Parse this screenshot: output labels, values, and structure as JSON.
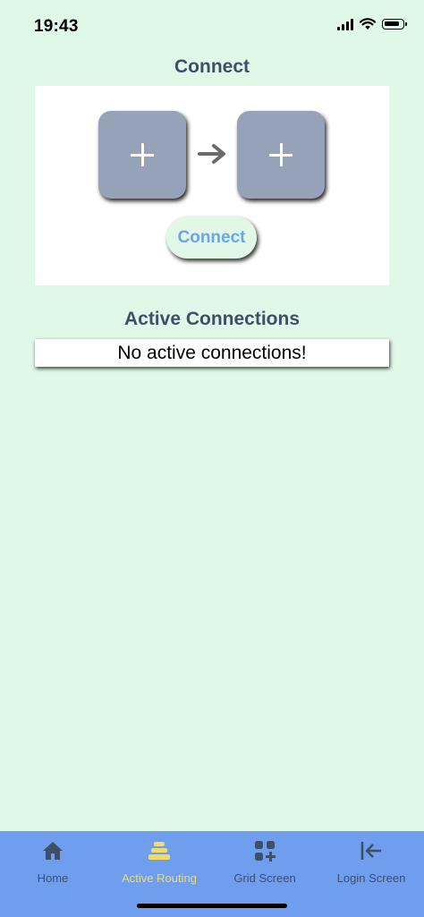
{
  "status_bar": {
    "time": "19:43",
    "icons": [
      "cellular-signal-icon",
      "wifi-icon",
      "battery-icon"
    ]
  },
  "connect_section": {
    "title": "Connect",
    "source_slot_icon": "plus-icon",
    "target_slot_icon": "plus-icon",
    "arrow_icon": "arrow-right-icon",
    "button_label": "Connect"
  },
  "active_connections": {
    "title": "Active Connections",
    "empty_message": "No active connections!"
  },
  "tab_bar": {
    "active_tab": "Active Routing",
    "active_color": "#f3dc63",
    "inactive_color": "#3f4f66",
    "background": "#6f9eef",
    "tabs": [
      {
        "label": "Home",
        "icon": "home-icon"
      },
      {
        "label": "Active Routing",
        "icon": "layers-icon"
      },
      {
        "label": "Grid Screen",
        "icon": "grid-add-icon"
      },
      {
        "label": "Login Screen",
        "icon": "login-arrow-icon"
      }
    ]
  },
  "colors": {
    "background": "#e0f8e8",
    "heading": "#3f4f66",
    "slot": "#96a2b8",
    "button_text": "#68a6ee"
  }
}
